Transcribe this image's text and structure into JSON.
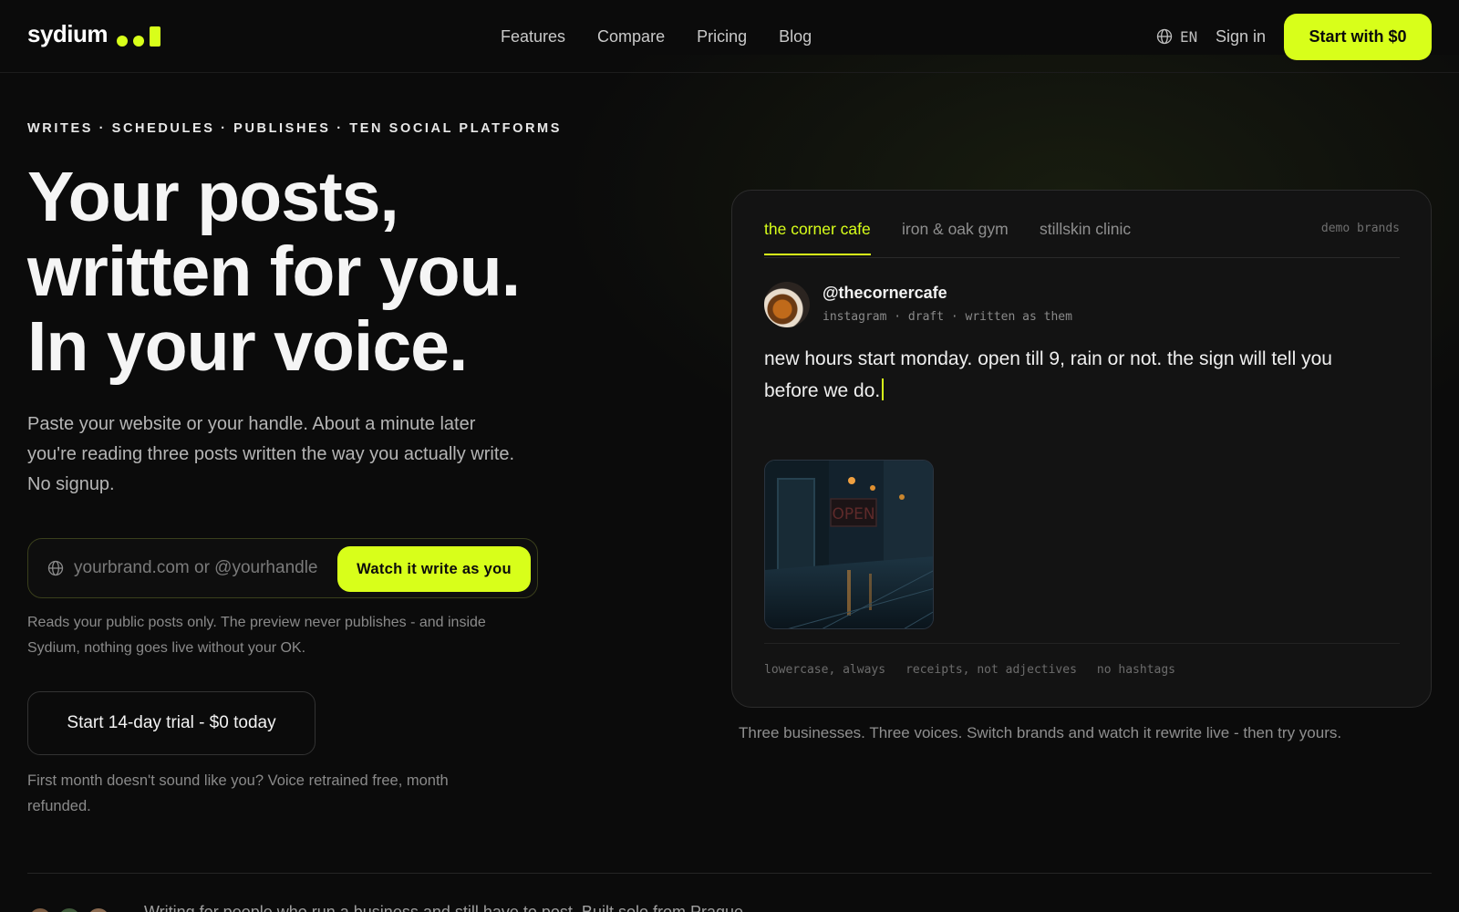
{
  "brand": {
    "name": "sydium"
  },
  "nav": {
    "links": [
      "Features",
      "Compare",
      "Pricing",
      "Blog"
    ],
    "language": "EN",
    "sign_in": "Sign in",
    "cta": "Start with $0"
  },
  "hero": {
    "eyebrow": "WRITES · SCHEDULES · PUBLISHES · TEN SOCIAL PLATFORMS",
    "headline": [
      "Your posts,",
      "written for you.",
      "In your voice."
    ],
    "subtitle": "Paste your website or your handle. About a minute later you're reading three posts written the way you actually write. No signup.",
    "input_placeholder": "yourbrand.com or @yourhandle",
    "input_button": "Watch it write as you",
    "privacy_note": "Reads your public posts only. The preview never publishes - and inside Sydium, nothing goes live without your OK.",
    "trial_button": "Start 14-day trial - $0 today",
    "guarantee_note": "First month doesn't sound like you? Voice retrained free, month refunded."
  },
  "demo": {
    "tabs": [
      "the corner cafe",
      "iron & oak gym",
      "stillskin clinic"
    ],
    "active_tab": 0,
    "demo_label": "demo brands",
    "handle": "@thecornercafe",
    "meta": "instagram · draft · written as them",
    "post_text": "new hours start monday. open till 9, rain or not. the sign will tell you before we do.",
    "image_sign": "OPEN",
    "voice_tags": [
      "lowercase, always",
      "receipts, not adjectives",
      "no hashtags"
    ],
    "caption": "Three businesses. Three voices. Switch brands and watch it rewrite live - then try yours."
  },
  "footer": {
    "social_proof": "Writing for people who run a business and still have to post. Built solo from Prague."
  },
  "colors": {
    "accent": "#d8ff1a",
    "background": "#0b0b0b",
    "card": "#131313"
  }
}
